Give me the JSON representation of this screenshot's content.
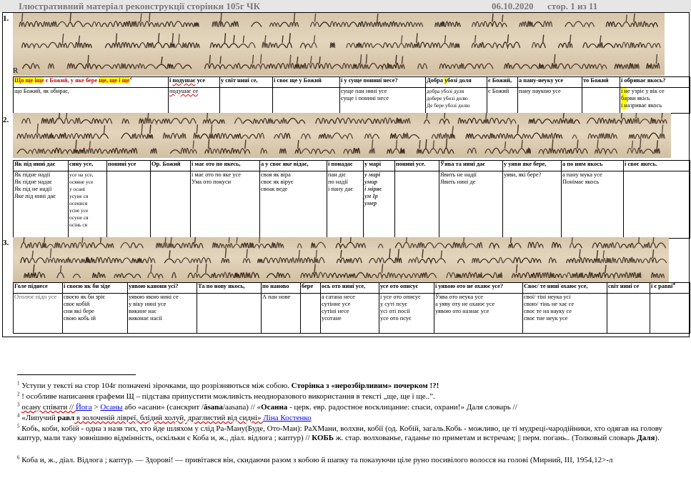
{
  "header": {
    "title": "Ілюстративний матеріал  реконструкції сторінки 105г ЧК",
    "date": "06.10.2020",
    "page": "стор. 1 из 11"
  },
  "sections": [
    {
      "num": "1.",
      "r_label": "R",
      "headers": [
        {
          "pre": "",
          "hl": "Що ще іще",
          "mid": " є Божий, у яке бере ",
          "hl2": "ще, ще і ще",
          "sup": "2"
        },
        {
          "pre": "і ",
          "sq": "подушає",
          "post": " усе"
        },
        {
          "pre": "у світ нині се,"
        },
        {
          "pre": "і своє ще у Божий"
        },
        {
          "pre": "і у суще понині несе?"
        },
        {
          "pre": "Добра ",
          "hl": "у",
          "post": "бозі доля"
        },
        {
          "pre": "є Божий,"
        },
        {
          "pre": "а пану-неуку усе"
        },
        {
          "pre": "то Божий"
        },
        {
          "pre": "і обриває якось?"
        }
      ],
      "cells": [
        [
          "що Божий, як обирає,"
        ],
        [
          "подушає се"
        ],
        [
          ""
        ],
        [
          ""
        ],
        [
          "суще пан нині усе",
          "суще і понині несе"
        ],
        [
          "добра убозі дуля",
          "добере убозі долю",
          "Де бере убозі долю"
        ],
        [
          "є Божий"
        ],
        [
          "пану наукою усе"
        ],
        [
          ""
        ],
        [
          "і не узріє у вік се",
          "барви якісь",
          "і назриває якось"
        ]
      ]
    },
    {
      "num": "2.",
      "headers": [
        "Як під нині дає",
        "сину усе,",
        "понині усе",
        "Ор. Божий",
        "і має ото по якесь,",
        "а у своє яке відає,",
        "і понадає",
        "у марі",
        "понині усе.",
        "Ўява та нині дає",
        "у уяви яке бере,",
        "а по ним якось",
        "і своє якесь."
      ],
      "cells": [
        [
          "Як підне надії",
          "Як підне надає",
          "Як під не надії",
          "Яке під нині дає"
        ],
        [
          "усе на усе,",
          "осяяне усе",
          "у осані",
          "усуне ся",
          "осенися",
          "усне усе",
          "осуне ся",
          "осінь ся"
        ],
        [
          ""
        ],
        [
          ""
        ],
        [
          "і має ото по яке усе",
          "Ума ото покуси"
        ],
        [
          "своя як віра",
          "своє як вірує",
          "своак веде"
        ],
        [
          "пан діє",
          "по надії",
          "і пану дає"
        ],
        [
          "у марі",
          "умир",
          "і міряє",
          "ум Ір",
          "умер"
        ],
        [
          ""
        ],
        [
          "Явить не надії",
          "Явить нині де"
        ],
        [
          "уяви, які бере?"
        ],
        [
          "а пану мука усе",
          "Понімає якось"
        ],
        [
          ""
        ]
      ]
    },
    {
      "num": "3.",
      "headers": [
        "Голе піднесе",
        "і своєю як би зіде",
        "уявою канони усі?",
        "Та по нову якось,",
        "по наново",
        "бере",
        "ось ото нині усе,",
        "усе ото описує",
        "і уявою ото не охаює усе?",
        "Своє/ те нині охаює усе,",
        "світ нині се",
        "і є равві"
      ],
      "header_sup": "4",
      "cells": [
        [
          "Отолює підн усе"
        ],
        [
          "своєю як би зріє",
          "своє кобій",
          "сни які бере",
          "свою кобь ій"
        ],
        [
          "уявою якою нині се",
          "у віку нині усе",
          "викине нас",
          "виконає насії"
        ],
        [
          ""
        ],
        [
          "А пан нове"
        ],
        [
          ""
        ],
        [
          "а сатана несе",
          "сутінне усе",
          "сутіні несе",
          "усотане"
        ],
        [
          "і усе ото описує",
          "у суті псує",
          "усі оті посії",
          "усе ото псує"
        ],
        [
          "Ўява ото неука усе",
          "а уяву оту не охаює усе",
          "уявою ото назнає усе"
        ],
        [
          "свої/ тіні неука усі",
          "свою/ тінь не хає се",
          "своє те на науку се",
          "своє тне неук усе"
        ],
        [
          ""
        ],
        [
          ""
        ]
      ]
    }
  ],
  "footnotes": {
    "f1": "Уступи у тексті на стор 104г  позначені зірочками, що розрізняються між собою. ",
    "f1_bold": "Сторінка з «нерозбірливим» почерком !?!",
    "f2": "! особливе написання графеми Щ – підстава припустити можливість неодноразового використання в тексті „ще, ще і ще..”.",
    "f3a": "осану співати // ",
    "f3_link1": "Йога",
    "f3_gt": " > ",
    "f3_link2": "Осаны",
    "f3b": " або «асани» (санскрит /",
    "f3_bold1": "āsana",
    "f3c": "/aasana) // «",
    "f3_bold2": "Осанна",
    "f3d": " - церк. евр. радостное восклицание: спаси, охрани!» Даля словарь //",
    "f4a": "«Липучий ",
    "f4_bold": "равл",
    "f4b": " в золоченій лівреї, блідий холуй, драглистий від сидні» ",
    "f4_link": "Ліна Костенко",
    "f5a": "Кобь, коби, кобій - одна з назв тих, хто йде шляхом у слід Ра-Ману(Буде, Ото-Ман): РаХМани, волхви, кобії (од. Кобій, загаль.Кобь - можливо, це ті мудреці-чародійники, хто одягав на голову каптур, мали таку зовнішню відмінність, оскільки є Коба и, ж., діал. відлога ; каптур) // ",
    "f5_bold": "КОБЬ",
    "f5b": " ж. стар. волхованье, гаданье по приметам и встречам; || перм. погань.. (Толковый словарь ",
    "f5_bold2": "Даля",
    "f5c": ").",
    "f6": "Коба и, ж., діал. Відлога ; каптур. — Здорові! — привітався він, скидаючи разом з кобою й шапку та показуючи ціле руно посивілого волосся на голові (Мирний, III, 1954,12>-л"
  },
  "colors": {
    "highlight": "#ffff00",
    "header_bg": "#e6e6e6",
    "parchment": "#dccbb0",
    "ink": "#3a2a1e"
  }
}
